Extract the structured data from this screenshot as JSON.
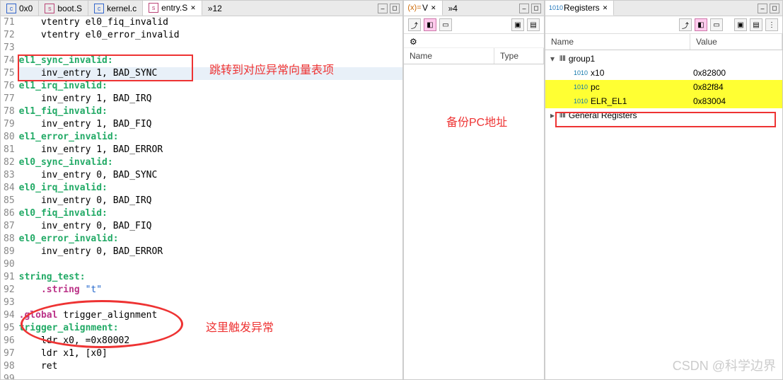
{
  "editor": {
    "tabs": [
      {
        "icon": "c",
        "label": "0x0"
      },
      {
        "icon": "s",
        "label": "boot.S"
      },
      {
        "icon": "c",
        "label": "kernel.c"
      },
      {
        "icon": "s",
        "label": "entry.S",
        "active": true
      }
    ],
    "extraTab": "»12",
    "startLine": 71,
    "lines": [
      {
        "text": "    vtentry el0_fiq_invalid"
      },
      {
        "text": "    vtentry el0_error_invalid"
      },
      {
        "text": ""
      },
      {
        "text": "el1_sync_invalid:",
        "label": true
      },
      {
        "text": "    inv_entry 1, BAD_SYNC",
        "hl": true
      },
      {
        "text": "el1_irq_invalid:",
        "label": true
      },
      {
        "text": "    inv_entry 1, BAD_IRQ"
      },
      {
        "text": "el1_fiq_invalid:",
        "label": true
      },
      {
        "text": "    inv_entry 1, BAD_FIQ"
      },
      {
        "text": "el1_error_invalid:",
        "label": true
      },
      {
        "text": "    inv_entry 1, BAD_ERROR"
      },
      {
        "text": "el0_sync_invalid:",
        "label": true
      },
      {
        "text": "    inv_entry 0, BAD_SYNC"
      },
      {
        "text": "el0_irq_invalid:",
        "label": true
      },
      {
        "text": "    inv_entry 0, BAD_IRQ"
      },
      {
        "text": "el0_fiq_invalid:",
        "label": true
      },
      {
        "text": "    inv_entry 0, BAD_FIQ"
      },
      {
        "text": "el0_error_invalid:",
        "label": true
      },
      {
        "text": "    inv_entry 0, BAD_ERROR"
      },
      {
        "text": ""
      },
      {
        "text": "string_test:",
        "label": true
      },
      {
        "text": "    .string \"t\"",
        "str": true
      },
      {
        "text": ""
      },
      {
        "text": ".global trigger_alignment",
        "kw": true
      },
      {
        "text": "trigger_alignment:",
        "label": true
      },
      {
        "text": "    ldr x0, =0x80002"
      },
      {
        "text": "    ldr x1, [x0]"
      },
      {
        "text": "    ret"
      },
      {
        "text": ""
      }
    ]
  },
  "annot": {
    "a1": "跳转到对应异常向量表项",
    "a2": "这里触发异常",
    "a3": "备份PC地址"
  },
  "vars": {
    "tab": "V",
    "extra": "»4",
    "cols": {
      "name": "Name",
      "type": "Type"
    }
  },
  "regs": {
    "tab": "Registers",
    "cols": {
      "name": "Name",
      "value": "Value"
    },
    "group": "group1",
    "rows": [
      {
        "name": "x10",
        "value": "0x82800"
      },
      {
        "name": "pc",
        "value": "0x82f84",
        "hl": true
      },
      {
        "name": "ELR_EL1",
        "value": "0x83004",
        "hl": true,
        "box": true
      }
    ],
    "general": "General Registers"
  },
  "watermark": "CSDN @科学边界"
}
